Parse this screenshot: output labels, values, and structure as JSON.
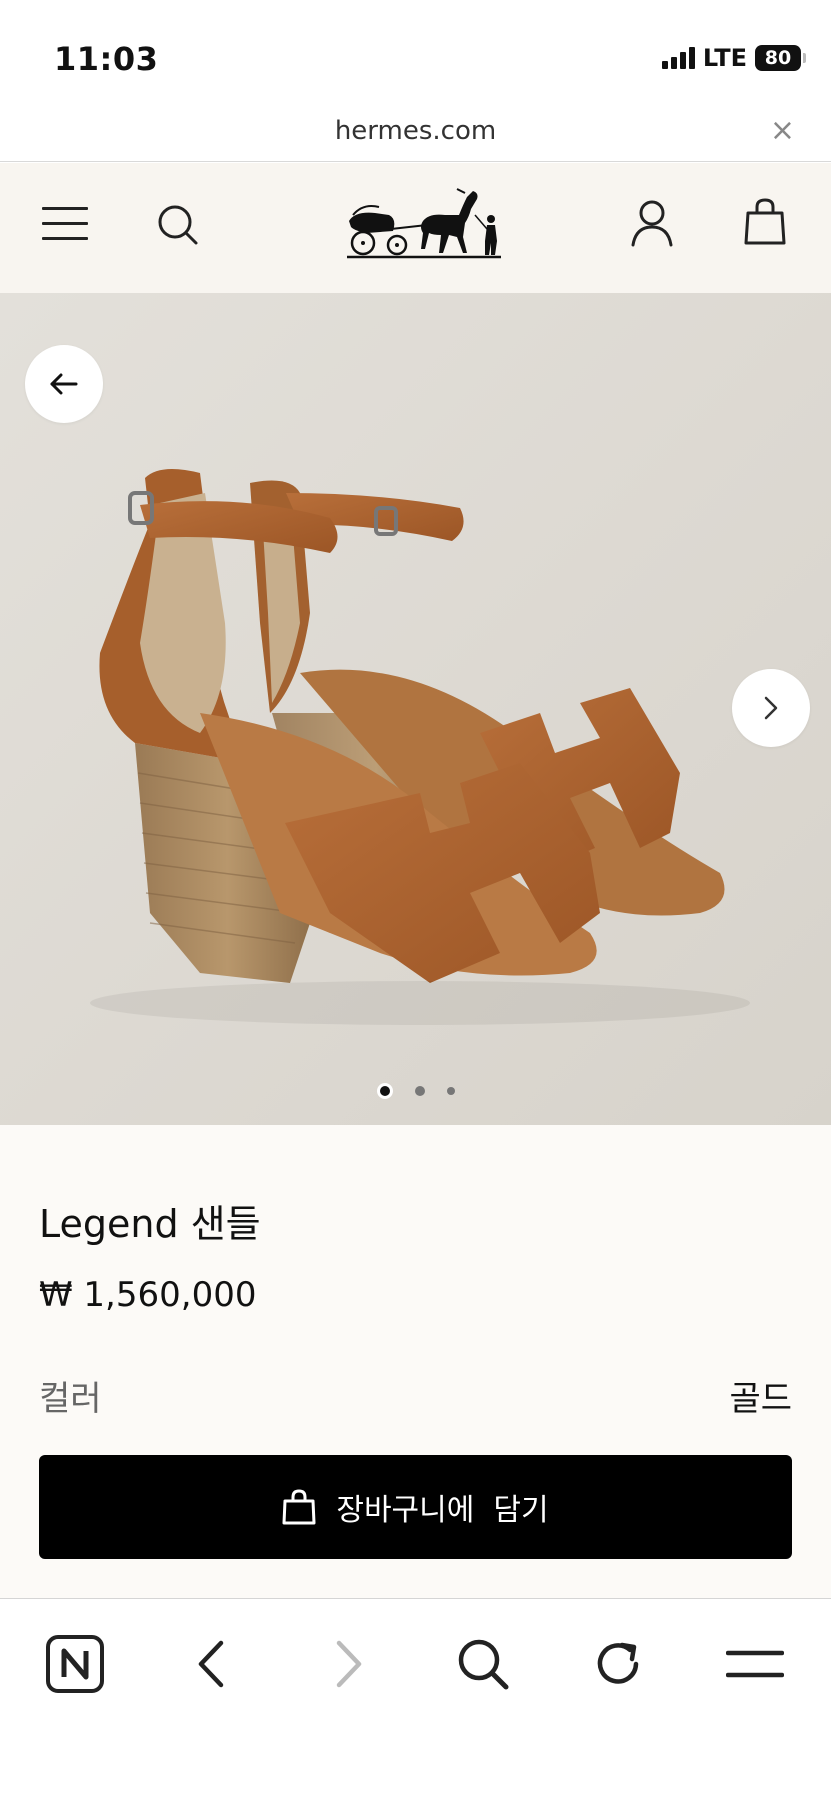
{
  "status_bar": {
    "time": "11:03",
    "network": "LTE",
    "battery": "80"
  },
  "browser": {
    "url": "hermes.com",
    "close_glyph": "×"
  },
  "header": {
    "menu_icon": "hamburger-menu-icon",
    "search_icon": "search-icon",
    "logo": "hermes-carriage-logo",
    "account_icon": "user-icon",
    "bag_icon": "shopping-bag-icon"
  },
  "gallery": {
    "image": "brown-leather-wedge-sandals",
    "slide_count": 3,
    "active_slide": 1,
    "prev_icon": "arrow-left-icon",
    "next_icon": "chevron-right-icon"
  },
  "product": {
    "name": "Legend 샌들",
    "price": "₩ 1,560,000",
    "color_label": "컬러",
    "color_value": "골드",
    "cta_label": "장바구니에  담기",
    "cta_icon": "shopping-bag-icon"
  },
  "toolbar": {
    "items": [
      "naver-n-icon",
      "back-icon",
      "forward-icon",
      "search-icon",
      "reload-icon",
      "menu-icon"
    ]
  },
  "colors": {
    "header_bg": "#f8f5f0",
    "details_bg": "#fcfaf7",
    "cta_bg": "#000000",
    "leather": "#b06a38"
  }
}
